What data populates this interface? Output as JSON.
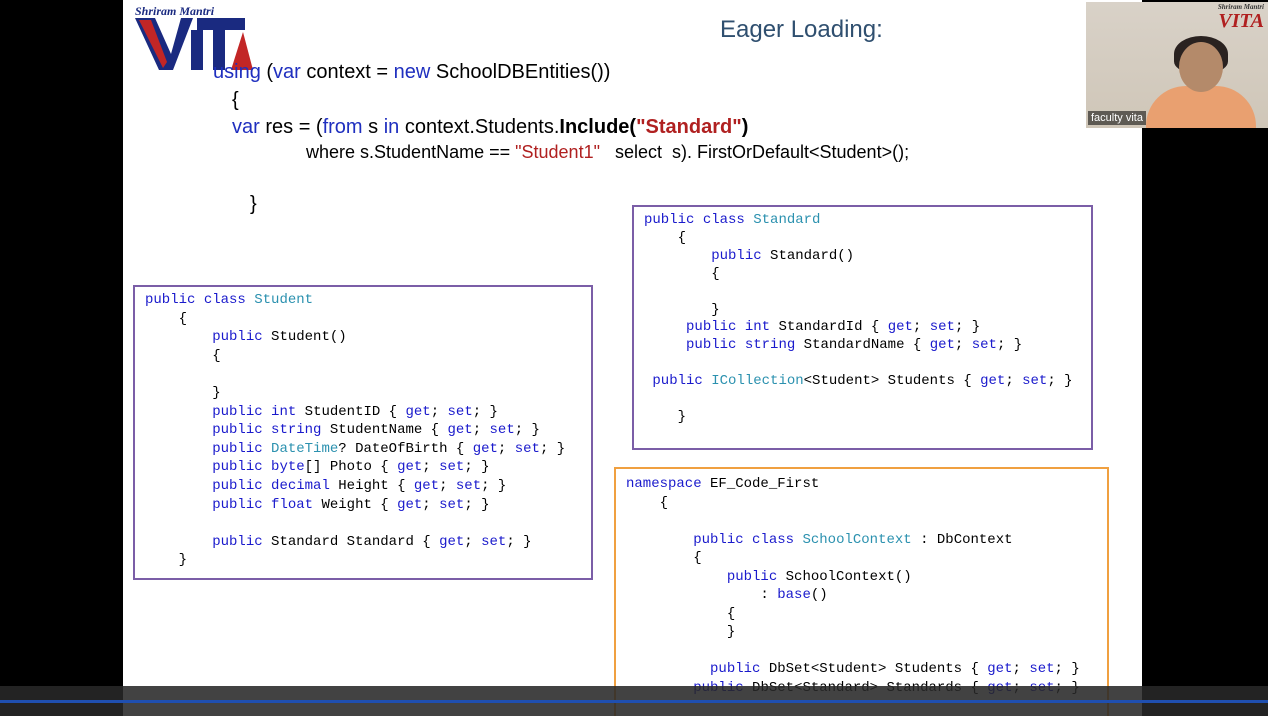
{
  "slide": {
    "title": "Eager Loading:",
    "logo_text": "Shriram Mantri",
    "code_lines": {
      "l1_a": "using",
      "l1_b": " (",
      "l1_c": "var",
      "l1_d": " context = ",
      "l1_e": "new",
      "l1_f": " SchoolDBEntities())",
      "l2": "{",
      "l3_a": "var",
      "l3_b": " res = (",
      "l3_c": "from",
      "l3_d": " s ",
      "l3_e": "in",
      "l3_f": " context.Students.",
      "l3_g": "Include(",
      "l3_h": "\"Standard\"",
      "l3_i": ")",
      "l4_a": "where s.StudentName == ",
      "l4_b": "\"Student1\"",
      "l4_c": "   select  s). FirstOrDefault<Student>();",
      "l5": "}"
    }
  },
  "student_box": [
    "public class Student",
    "    {",
    "        public Student()",
    "        {",
    "",
    "        }",
    "        public int StudentID { get; set; }",
    "        public string StudentName { get; set; }",
    "        public DateTime? DateOfBirth { get; set; }",
    "        public byte[] Photo { get; set; }",
    "        public decimal Height { get; set; }",
    "        public float Weight { get; set; }",
    "",
    "        public Standard Standard { get; set; }",
    "    }"
  ],
  "standard_box": [
    "public class Standard",
    "    {",
    "        public Standard()",
    "        {",
    "",
    "        }",
    "     public int StandardId { get; set; }",
    "     public string StandardName { get; set; }",
    "",
    " public ICollection<Student> Students { get; set; }",
    "",
    "    }"
  ],
  "context_box": [
    "namespace EF_Code_First",
    "    {",
    "",
    "        public class SchoolContext : DbContext",
    "        {",
    "            public SchoolContext()",
    "                : base()",
    "            {",
    "            }",
    "",
    "          public DbSet<Student> Students { get; set; }",
    "        public DbSet<Standard> Standards { get; set; }"
  ],
  "webcam": {
    "name": "faculty vita",
    "logo": "VITA",
    "logo_small": "Shriram Mantri"
  }
}
